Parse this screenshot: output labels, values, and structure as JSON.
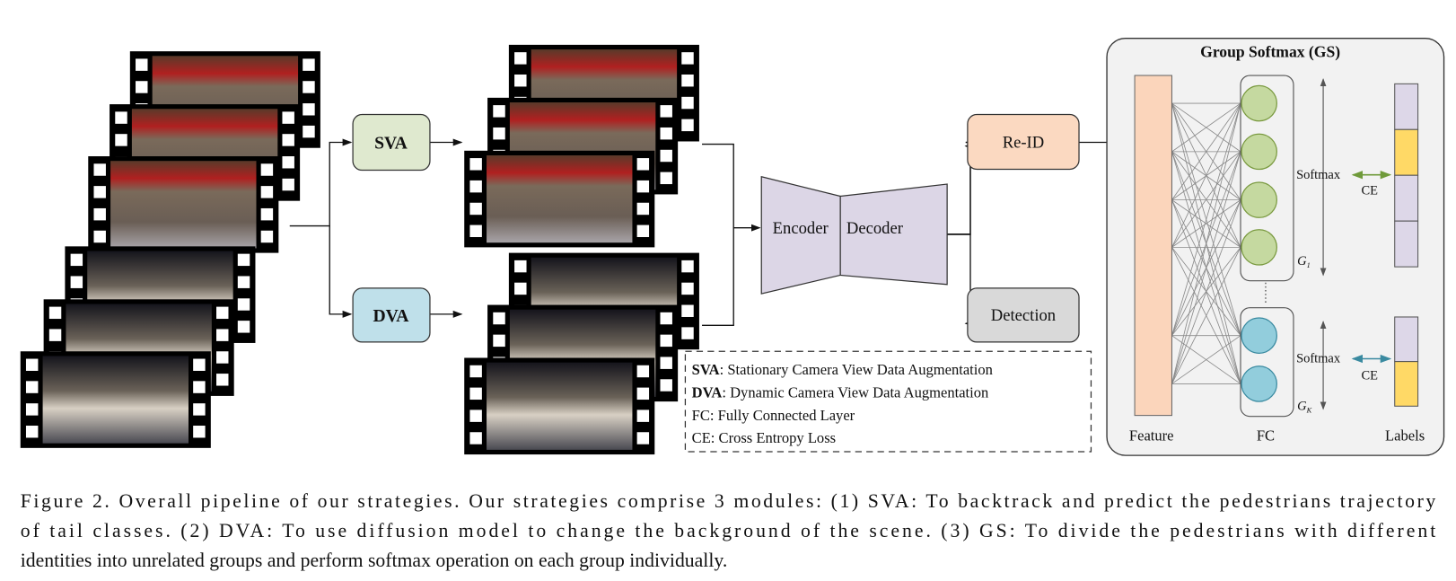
{
  "figure": {
    "sva_label": "SVA",
    "dva_label": "DVA",
    "encoder_label": "Encoder",
    "decoder_label": "Decoder",
    "reid_label": "Re-ID",
    "detection_label": "Detection",
    "gs_title": "Group Softmax (GS)",
    "feature_label": "Feature",
    "fc_label": "FC",
    "labels_label": "Labels",
    "softmax_label": "Softmax",
    "ce_label": "CE",
    "group1_label": "G",
    "group1_sub": "1",
    "groupk_label": "G",
    "groupk_sub": "K",
    "legend": [
      {
        "key": "SVA",
        "text": ": Stationary Camera View Data Augmentation"
      },
      {
        "key": "DVA",
        "text": ": Dynamic Camera View Data Augmentation"
      },
      {
        "key": "",
        "text": "FC: Fully Connected Layer"
      },
      {
        "key": "",
        "text": "CE: Cross Entropy Loss"
      }
    ],
    "colors": {
      "sva_box": "#dfe9cf",
      "dva_box": "#bfe0ea",
      "encoder_decoder": "#dcd6e6",
      "reid_box": "#fbd9c1",
      "detection_box": "#d9d9d9",
      "feature_bar": "#fbd5bb",
      "group1_nodes": "#c5d9a0",
      "groupk_nodes": "#92cddc",
      "label_cell": "#ddd7e8",
      "label_active": "#ffd966",
      "gs_panel": "#f2f2f2"
    }
  },
  "caption": [
    "Figure 2. Overall pipeline of our strategies. Our strategies comprise 3 modules: (1) SVA: To backtrack and predict the pedestrians trajectory",
    "of tail classes. (2) DVA: To use diffusion model to change the background of the scene. (3) GS: To divide the pedestrians with different",
    "identities into unrelated groups and perform softmax operation on each group individually."
  ]
}
